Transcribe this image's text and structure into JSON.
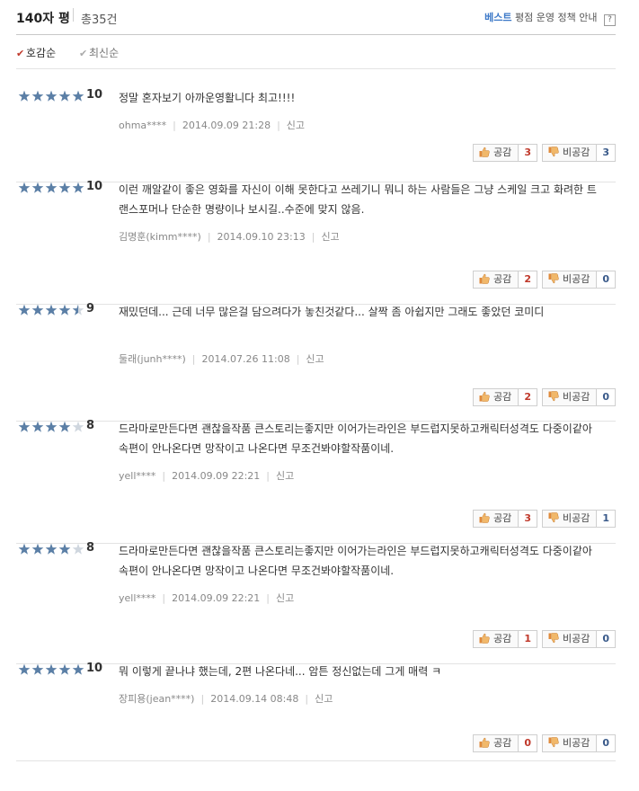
{
  "header": {
    "title": "140자 평",
    "total": "총35건",
    "best": "베스트",
    "policy": "평점 운영 정책 안내",
    "help": "?"
  },
  "sort": {
    "option1": "호감순",
    "option2": "최신순"
  },
  "reviews": [
    {
      "stars": 5,
      "score": "10",
      "text": "정말 혼자보기 아까운영활니다 최고!!!!",
      "user": "ohma****",
      "date": "2014.09.09 21:28",
      "report": "신고",
      "like_label": "공감",
      "like": "3",
      "dislike_label": "비공감",
      "dislike": "3"
    },
    {
      "stars": 5,
      "score": "10",
      "text": "이런 깨알같이 좋은 영화를 자신이 이해 못한다고 쓰레기니 뭐니 하는 사람들은 그냥 스케일 크고 화려한 트랜스포머나 단순한 명량이나 보시길..수준에 맞지 않음.",
      "user": "김명훈(kimm****)",
      "date": "2014.09.10 23:13",
      "report": "신고",
      "like_label": "공감",
      "like": "2",
      "dislike_label": "비공감",
      "dislike": "0"
    },
    {
      "stars": 4.5,
      "score": "9",
      "text": "재밌던데... 근데 너무 많은걸 담으려다가 놓친것같다... 살짝 좀 아쉽지만 그래도 좋았던 코미디",
      "user": "둘래(junh****)",
      "date": "2014.07.26 11:08",
      "report": "신고",
      "like_label": "공감",
      "like": "2",
      "dislike_label": "비공감",
      "dislike": "0"
    },
    {
      "stars": 4,
      "score": "8",
      "text": "드라마로만든다면 괜찮을작품 큰스토리는좋지만 이어가는라인은 부드럽지못하고캐릭터성격도 다중이같아 속편이 안나온다면 망작이고 나온다면 무조건봐야할작품이네.",
      "user": "yell****",
      "date": "2014.09.09 22:21",
      "report": "신고",
      "like_label": "공감",
      "like": "3",
      "dislike_label": "비공감",
      "dislike": "1"
    },
    {
      "stars": 4,
      "score": "8",
      "text": "드라마로만든다면 괜찮을작품 큰스토리는좋지만 이어가는라인은 부드럽지못하고캐릭터성격도 다중이같아 속편이 안나온다면 망작이고 나온다면 무조건봐야할작품이네.",
      "user": "yell****",
      "date": "2014.09.09 22:21",
      "report": "신고",
      "like_label": "공감",
      "like": "1",
      "dislike_label": "비공감",
      "dislike": "0"
    },
    {
      "stars": 5,
      "score": "10",
      "text": "뭐 이렇게 끝나냐 했는데, 2편 나온다네... 암튼 정신없는데 그게 매력 ㅋ",
      "user": "장피용(jean****)",
      "date": "2014.09.14 08:48",
      "report": "신고",
      "like_label": "공감",
      "like": "0",
      "dislike_label": "비공감",
      "dislike": "0"
    }
  ],
  "colors": {
    "star": "#5b7fa6",
    "star_empty": "#cfd6de",
    "best": "#3d79c8",
    "like_count": "#c0392b"
  },
  "icons": {
    "like": "thumbs-up-icon",
    "dislike": "thumbs-down-icon",
    "check": "check-icon"
  }
}
